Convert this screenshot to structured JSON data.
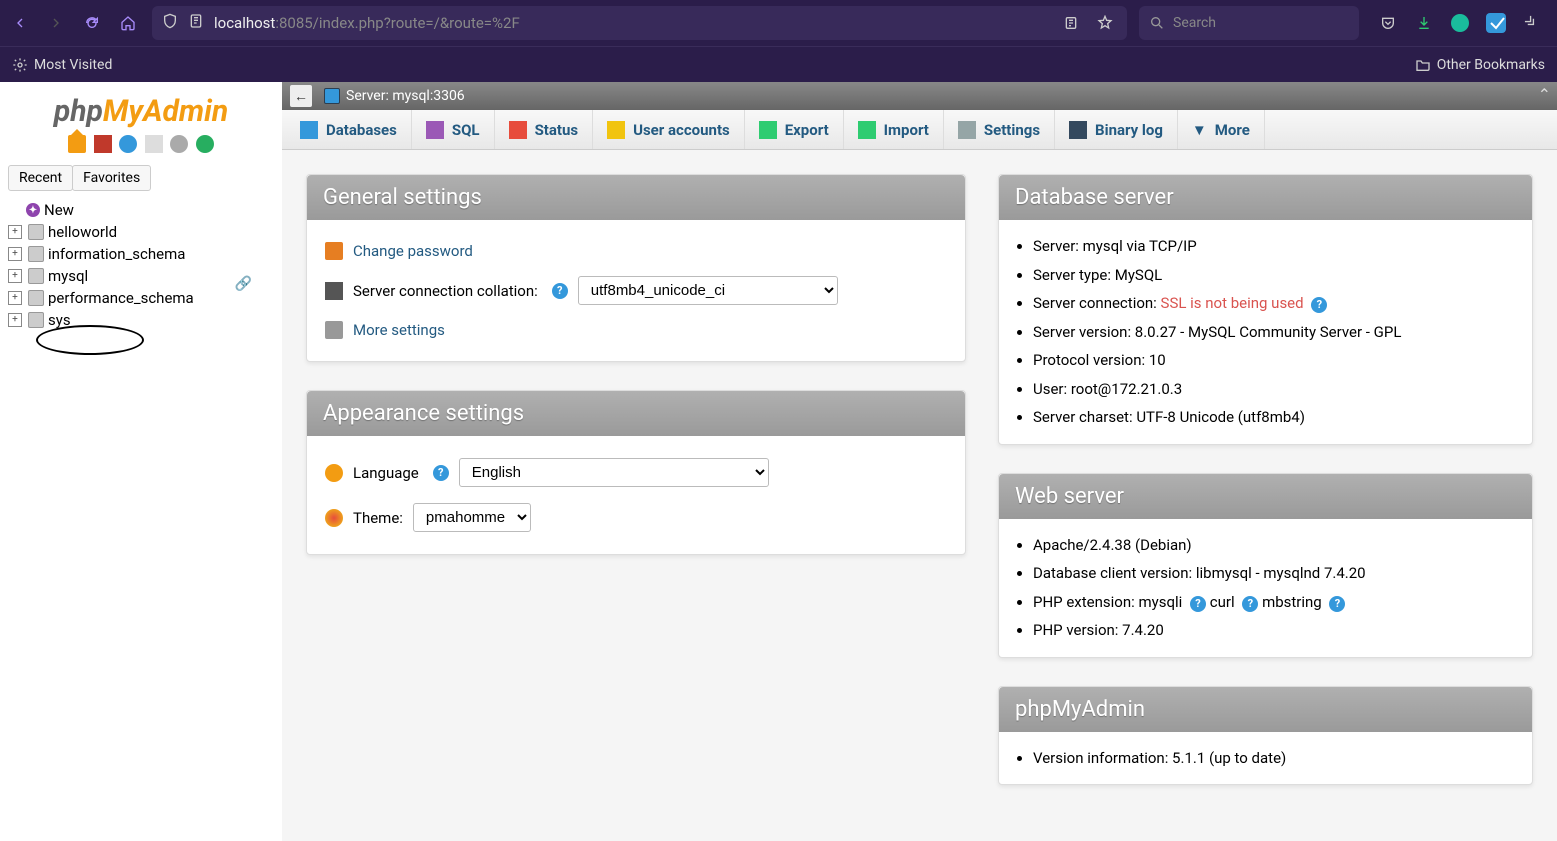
{
  "browser": {
    "url_host": "localhost",
    "url_path": ":8085/index.php?route=/&route=%2F",
    "search_placeholder": "Search",
    "most_visited": "Most Visited",
    "other_bookmarks": "Other Bookmarks"
  },
  "sidebar": {
    "logo_a": "php",
    "logo_b": "MyAdmin",
    "tabs": {
      "recent": "Recent",
      "favorites": "Favorites"
    },
    "new": "New",
    "items": [
      "helloworld",
      "information_schema",
      "mysql",
      "performance_schema",
      "sys"
    ]
  },
  "breadcrumb": {
    "label": "Server: mysql:3306"
  },
  "topmenu": {
    "databases": "Databases",
    "sql": "SQL",
    "status": "Status",
    "users": "User accounts",
    "export": "Export",
    "import": "Import",
    "settings": "Settings",
    "binlog": "Binary log",
    "more": "More"
  },
  "general": {
    "title": "General settings",
    "change_pw": "Change password",
    "collation_label": "Server connection collation:",
    "collation_value": "utf8mb4_unicode_ci",
    "more": "More settings"
  },
  "appearance": {
    "title": "Appearance settings",
    "language_label": "Language",
    "language_value": "English",
    "theme_label": "Theme:",
    "theme_value": "pmahomme"
  },
  "dbserver": {
    "title": "Database server",
    "items": {
      "l0": "Server: mysql via TCP/IP",
      "l1": "Server type: MySQL",
      "l2a": "Server connection: ",
      "l2b": "SSL is not being used",
      "l3": "Server version: 8.0.27 - MySQL Community Server - GPL",
      "l4": "Protocol version: 10",
      "l5": "User: root@172.21.0.3",
      "l6": "Server charset: UTF-8 Unicode (utf8mb4)"
    }
  },
  "webserver": {
    "title": "Web server",
    "items": {
      "l0": "Apache/2.4.38 (Debian)",
      "l1": "Database client version: libmysql - mysqlnd 7.4.20",
      "l2a": "PHP extension: mysqli ",
      "l2b": " curl ",
      "l2c": " mbstring ",
      "l3": "PHP version: 7.4.20"
    }
  },
  "pma": {
    "title": "phpMyAdmin",
    "l0": "Version information: 5.1.1 (up to date)"
  }
}
